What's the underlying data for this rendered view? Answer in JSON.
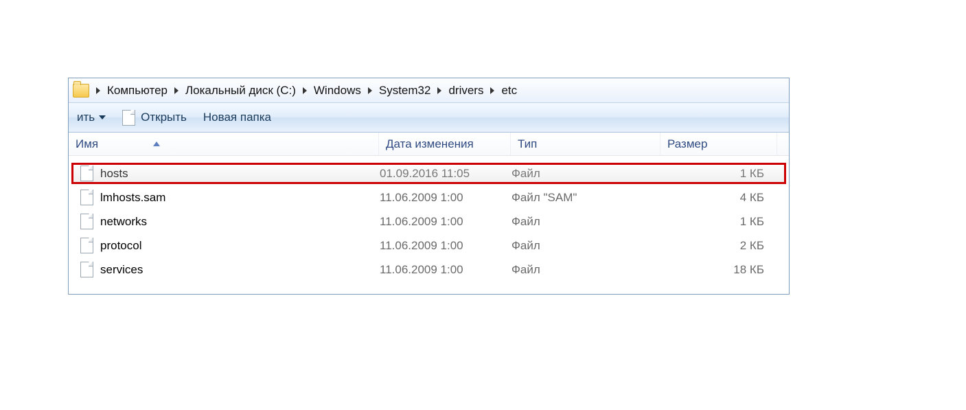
{
  "breadcrumb": [
    "Компьютер",
    "Локальный диск (C:)",
    "Windows",
    "System32",
    "drivers",
    "etc"
  ],
  "toolbar": {
    "organize": "ить",
    "open": "Открыть",
    "new_folder": "Новая папка"
  },
  "columns": {
    "name": "Имя",
    "date": "Дата изменения",
    "type": "Тип",
    "size": "Размер"
  },
  "files": [
    {
      "name": "hosts",
      "date": "01.09.2016 11:05",
      "type": "Файл",
      "size": "1 КБ",
      "highlight": true
    },
    {
      "name": "lmhosts.sam",
      "date": "11.06.2009 1:00",
      "type": "Файл \"SAM\"",
      "size": "4 КБ",
      "highlight": false
    },
    {
      "name": "networks",
      "date": "11.06.2009 1:00",
      "type": "Файл",
      "size": "1 КБ",
      "highlight": false
    },
    {
      "name": "protocol",
      "date": "11.06.2009 1:00",
      "type": "Файл",
      "size": "2 КБ",
      "highlight": false
    },
    {
      "name": "services",
      "date": "11.06.2009 1:00",
      "type": "Файл",
      "size": "18 КБ",
      "highlight": false
    }
  ]
}
